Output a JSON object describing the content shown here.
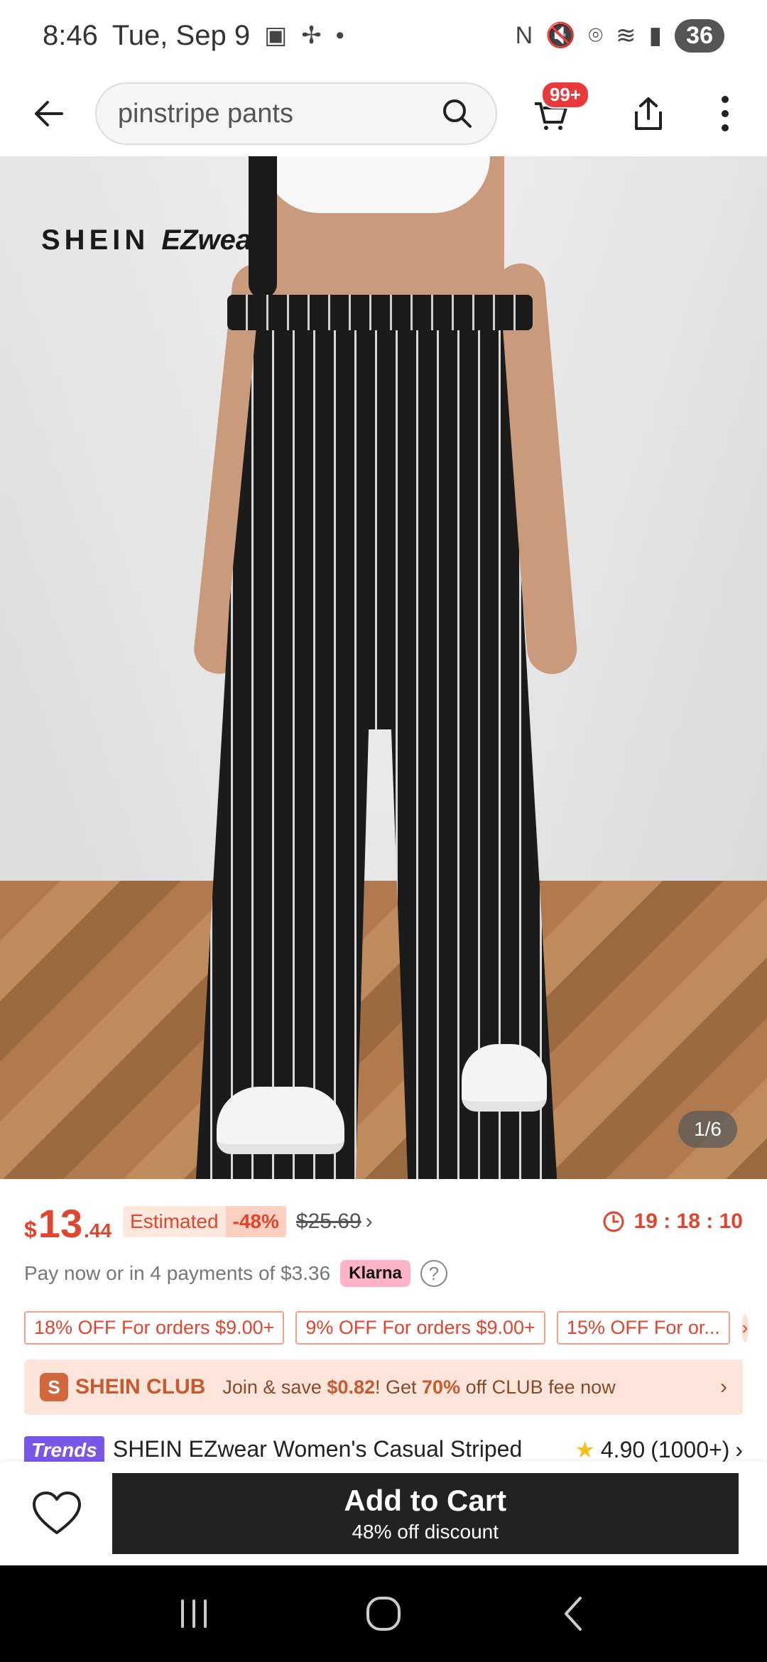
{
  "status_bar": {
    "time": "8:46",
    "date": "Tue, Sep 9",
    "battery": "36",
    "icons": [
      "screenshot-icon",
      "pinwheel-icon",
      "dot-icon",
      "nfc-icon",
      "mute-icon",
      "location-icon",
      "wifi-icon",
      "signal-icon"
    ]
  },
  "header": {
    "search_text": "pinstripe pants",
    "cart_badge": "99+"
  },
  "product_image": {
    "brand": "SHEIN",
    "brand_sub": "EZwear",
    "counter": "1/6"
  },
  "price": {
    "currency": "$",
    "whole": "13",
    "cents": ".44",
    "estimated_label": "Estimated",
    "discount_pct": "-48%",
    "original": "$25.69",
    "countdown": "19 : 18 : 10"
  },
  "payment": {
    "text": "Pay now or in 4 payments of $3.36",
    "provider": "Klarna"
  },
  "coupons": [
    "18% OFF For orders $9.00+",
    "9% OFF For orders $9.00+",
    "15% OFF For or..."
  ],
  "club": {
    "badge": "S",
    "name": "SHEIN CLUB",
    "desc_prefix": "Join & save ",
    "save_amount": "$0.82",
    "desc_mid": "! Get ",
    "off_pct": "70%",
    "desc_suffix": " off CLUB fee now"
  },
  "title_row": {
    "tag": "Trends",
    "title": "SHEIN EZwear Women's Casual Striped",
    "rating": "4.90",
    "rating_count": "(1000+)"
  },
  "action": {
    "add_to_cart": "Add to Cart",
    "discount_note": "48% off discount"
  },
  "colors": {
    "accent": "#e0452d",
    "club_bg": "#fde5dc",
    "button_bg": "#222222",
    "trends": "#7b57e8",
    "klarna": "#ffb3c7"
  }
}
